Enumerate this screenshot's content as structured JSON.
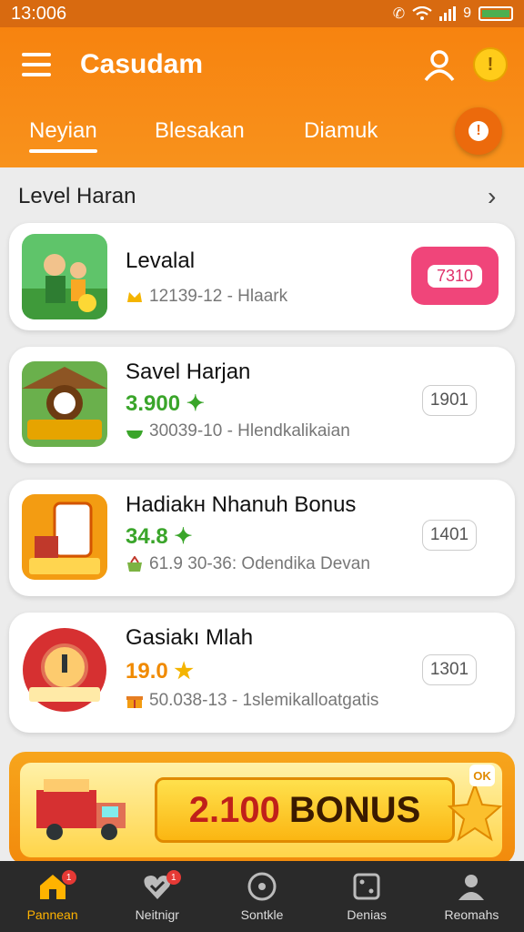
{
  "status_bar": {
    "time": "13:006",
    "battery_text": "9"
  },
  "header": {
    "title": "Casudam",
    "coin_glyph": "!",
    "tabs": [
      {
        "label": "Neyian",
        "active": true
      },
      {
        "label": "Blesakan",
        "active": false
      },
      {
        "label": "Diamuk",
        "active": false
      }
    ],
    "alert_glyph": "!"
  },
  "section": {
    "title": "Level Haran",
    "chevron": "›"
  },
  "cards": [
    {
      "title": "Levalal",
      "meta": "12139-12 - Hlaark",
      "button": "7310"
    },
    {
      "title": "Savel Harjan",
      "value": "3.900",
      "value_color": "#3aa52a",
      "meta": "30039-10 - Hlendkalikaian",
      "button": "1901"
    },
    {
      "title": "Hadiakн Nhanuh Bonus",
      "value": "34.8",
      "value_color": "#3aa52a",
      "meta": "61.9 30-36: Odendika Devan",
      "button": "1401"
    },
    {
      "title": "Gasiakı Mlah",
      "value": "19.0",
      "value_color": "#f08a00",
      "meta": "50.038-13 - 1slemikalloatgatis",
      "button": "1301"
    }
  ],
  "banner": {
    "amount": "2.100",
    "word": "BONUS",
    "close_label": "OK"
  },
  "bottom_nav": [
    {
      "label": "Pannean",
      "icon": "home-icon",
      "active": true,
      "badge": "1"
    },
    {
      "label": "Neitnigr",
      "icon": "heart-check-icon",
      "active": false,
      "badge": "1"
    },
    {
      "label": "Sontkle",
      "icon": "target-icon",
      "active": false
    },
    {
      "label": "Denias",
      "icon": "dice-icon",
      "active": false
    },
    {
      "label": "Reomahs",
      "icon": "profile-icon",
      "active": false
    }
  ],
  "colors": {
    "brand_orange": "#f7830f",
    "accent_pink": "#f0457a",
    "value_green": "#3aa52a",
    "value_orange": "#f08a00"
  }
}
